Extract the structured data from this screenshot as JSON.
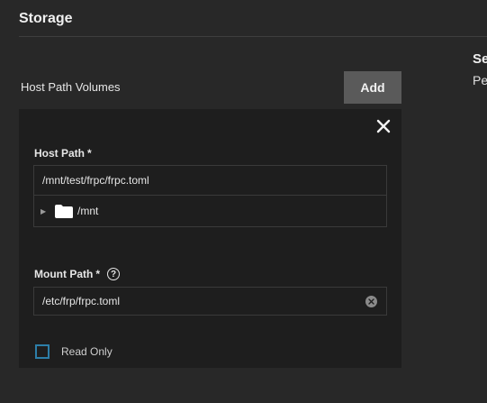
{
  "section": {
    "title": "Storage"
  },
  "right_panel": {
    "heading": "Se",
    "sub": "Pe"
  },
  "host_path_volumes": {
    "label": "Host Path Volumes",
    "add_label": "Add"
  },
  "host_path": {
    "label": "Host Path",
    "required_mark": "*",
    "value": "/mnt/test/frpc/frpc.toml",
    "tree": [
      {
        "name": "/mnt",
        "expanded": false
      }
    ]
  },
  "mount_path": {
    "label": "Mount Path",
    "required_mark": "*",
    "help_glyph": "?",
    "value": "/etc/frp/frpc.toml"
  },
  "read_only": {
    "label": "Read Only",
    "checked": false
  },
  "colors": {
    "background": "#282828",
    "card": "#1e1e1e",
    "button": "#5a5a5a",
    "checkbox_border": "#2d7ea8"
  },
  "icons": [
    "close-icon",
    "caret-right-icon",
    "folder-icon",
    "help-icon",
    "clear-icon"
  ]
}
